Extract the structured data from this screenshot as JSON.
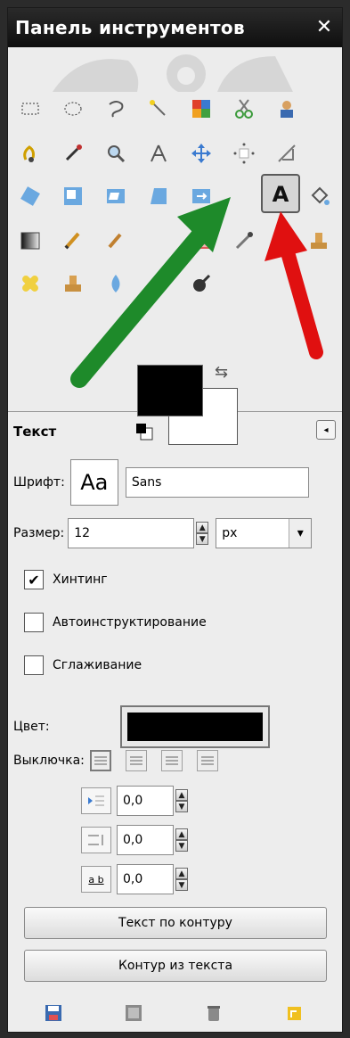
{
  "window": {
    "title": "Панель инструментов",
    "close_icon": "close-icon"
  },
  "toolbox": {
    "tools": [
      {
        "name": "rect-select-icon"
      },
      {
        "name": "ellipse-select-icon"
      },
      {
        "name": "free-select-icon"
      },
      {
        "name": "fuzzy-select-icon"
      },
      {
        "name": "color-select-icon"
      },
      {
        "name": "scissors-icon"
      },
      {
        "name": "foreground-select-icon"
      },
      {
        "name": "paths-icon"
      },
      {
        "name": "color-picker-icon"
      },
      {
        "name": "zoom-icon"
      },
      {
        "name": "measure-icon"
      },
      {
        "name": "move-icon"
      },
      {
        "name": "align-icon"
      },
      {
        "name": "crop-icon"
      },
      {
        "name": "rotate-icon"
      },
      {
        "name": "scale-icon"
      },
      {
        "name": "shear-icon"
      },
      {
        "name": "perspective-icon"
      },
      {
        "name": "flip-icon"
      },
      {
        "name": "text-tool-icon"
      },
      {
        "name": "bucket-fill-icon"
      },
      {
        "name": "blend-icon"
      },
      {
        "name": "pencil-icon"
      },
      {
        "name": "paintbrush-icon"
      },
      {
        "name": "eraser-icon"
      },
      {
        "name": "airbrush-icon"
      },
      {
        "name": "ink-icon"
      },
      {
        "name": "clone-icon"
      },
      {
        "name": "heal-icon"
      },
      {
        "name": "perspective-clone-icon"
      },
      {
        "name": "blur-icon"
      },
      {
        "name": "smudge-icon"
      },
      {
        "name": "dodge-burn-icon"
      }
    ],
    "foreground_color": "#000000",
    "background_color": "#ffffff"
  },
  "options": {
    "title": "Текст",
    "font_label": "Шрифт:",
    "font_preview": "Aa",
    "font_value": "Sans",
    "size_label": "Размер:",
    "size_value": "12",
    "unit_value": "px",
    "hinting_label": "Хинтинг",
    "hinting_checked": true,
    "autohint_label": "Автоинструктирование",
    "antialias_label": "Сглаживание",
    "color_label": "Цвет:",
    "color_value": "#000000",
    "justify_label": "Выключка:",
    "indent_value": "0,0",
    "line_spacing_value": "0,0",
    "letter_spacing_value": "0,0",
    "letter_icon_text": "a b",
    "text_along_path_label": "Текст по контуру",
    "path_from_text_label": "Контур из текста"
  },
  "annotations": {
    "green_arrow_color": "#1e8a2a",
    "red_arrow_color": "#e01010"
  }
}
